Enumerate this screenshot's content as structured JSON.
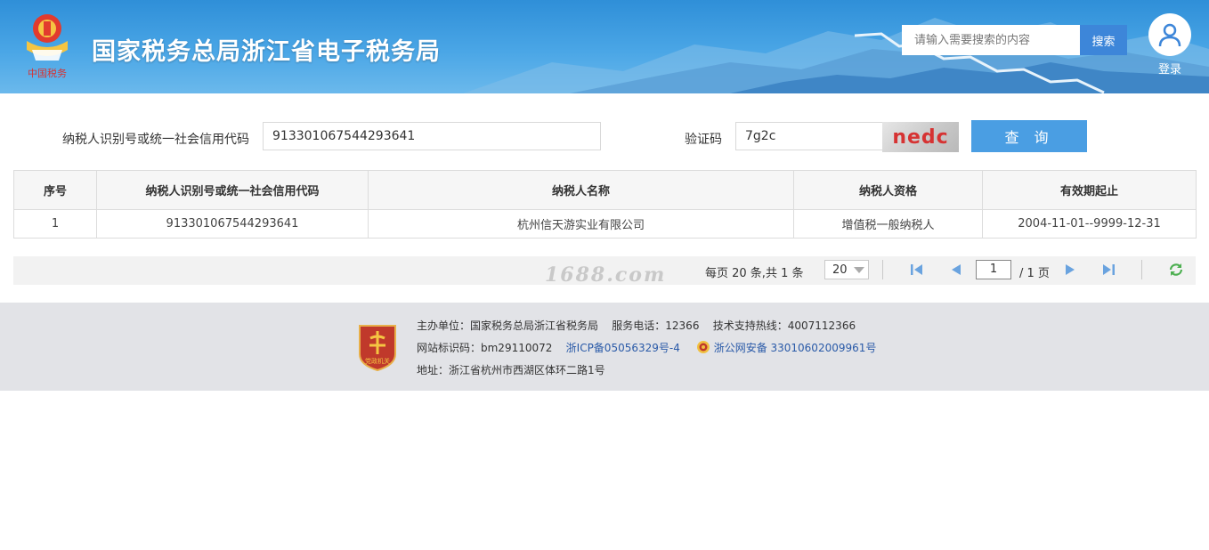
{
  "header": {
    "site_title": "国家税务总局浙江省电子税务局",
    "emblem_caption": "中国税务",
    "search_placeholder": "请输入需要搜索的内容",
    "search_button": "搜索",
    "login_label": "登录"
  },
  "query": {
    "taxpayer_id_label": "纳税人识别号或统一社会信用代码",
    "taxpayer_id_value": "913301067544293641",
    "captcha_label": "验证码",
    "captcha_value": "7g2c",
    "captcha_image_text": "nedc",
    "query_button": "查 询"
  },
  "table": {
    "headers": [
      "序号",
      "纳税人识别号或统一社会信用代码",
      "纳税人名称",
      "纳税人资格",
      "有效期起止"
    ],
    "rows": [
      [
        "1",
        "913301067544293641",
        "杭州信天游实业有限公司",
        "增值税一般纳税人",
        "2004-11-01--9999-12-31"
      ]
    ]
  },
  "pager": {
    "watermark": "1688.com",
    "summary": "每页 20 条,共 1 条",
    "page_size": "20",
    "current_page": "1",
    "total_pages": "/ 1 页"
  },
  "footer": {
    "sponsor": "主办单位：国家税务总局浙江省税务局",
    "phone": "服务电话：12366",
    "support": "技术支持热线：4007112366",
    "site_id": "网站标识码：bm29110072",
    "icp": "浙ICP备05056329号-4",
    "police_record": "浙公网安备 33010602009961号",
    "address": "地址：浙江省杭州市西湖区体环二路1号",
    "badge_text": "党政机关"
  },
  "colors": {
    "header_blue": "#2f8fd8",
    "button_blue": "#4a9ee3",
    "captcha_red": "#d63333",
    "link_blue": "#2a5aa8",
    "pager_icon": "#6aa3df",
    "refresh_green": "#4caf50"
  }
}
